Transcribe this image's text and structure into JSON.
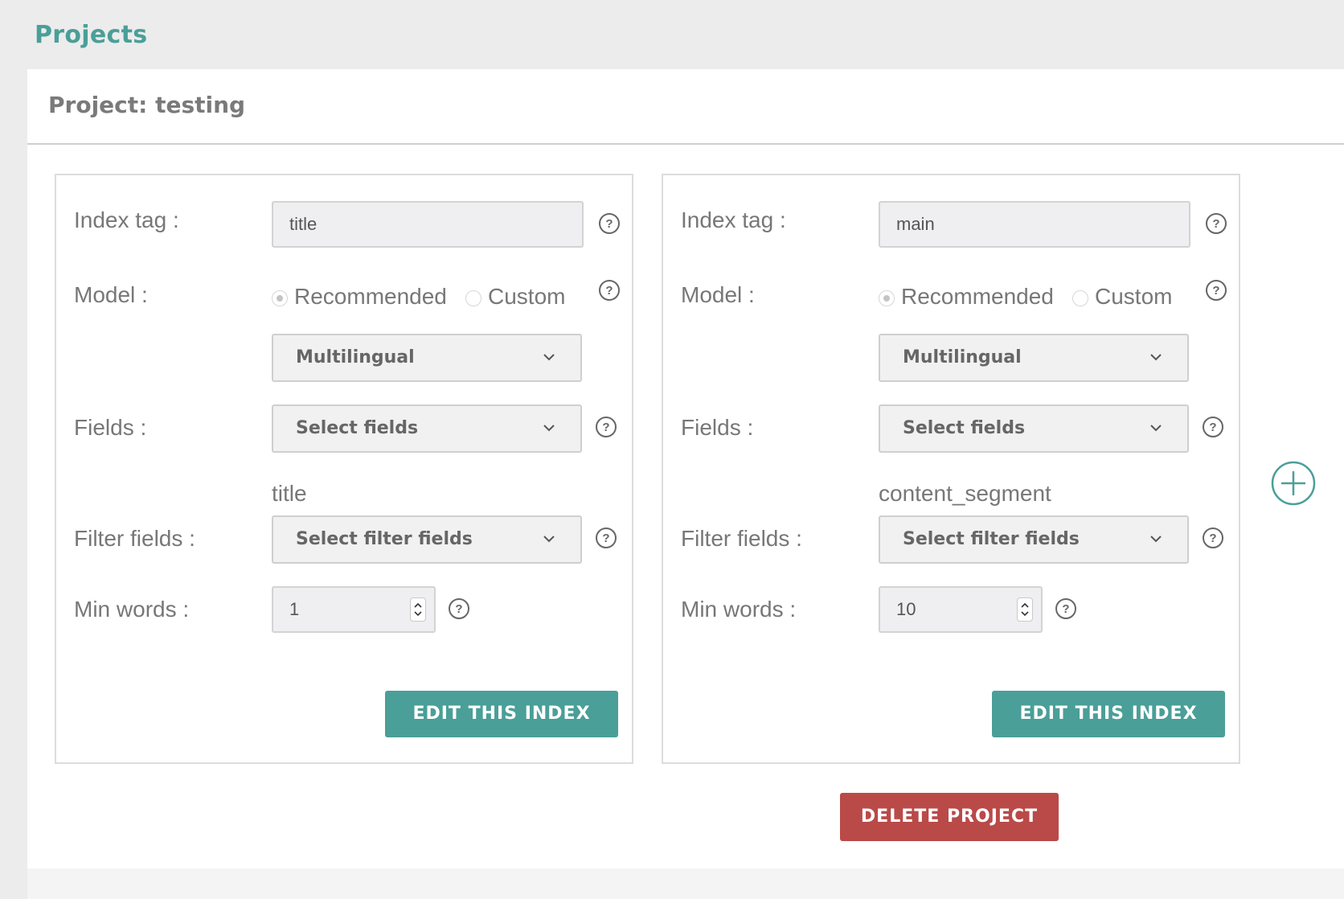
{
  "header": {
    "title": "Projects"
  },
  "project": {
    "title": "Project: testing"
  },
  "labels": {
    "index_tag": "Index tag :",
    "model": "Model :",
    "fields": "Fields :",
    "filter_fields": "Filter fields :",
    "min_words": "Min words :"
  },
  "model_options": {
    "recommended": "Recommended",
    "custom": "Custom"
  },
  "cards": [
    {
      "index_tag": "title",
      "model_selected": "Recommended",
      "model_value": "Multilingual",
      "fields_placeholder": "Select fields",
      "fields_value": "title",
      "filter_fields_placeholder": "Select filter fields",
      "min_words": "1",
      "edit_label": "EDIT THIS INDEX"
    },
    {
      "index_tag": "main",
      "model_selected": "Recommended",
      "model_value": "Multilingual",
      "fields_placeholder": "Select fields",
      "fields_value": "content_segment",
      "filter_fields_placeholder": "Select filter fields",
      "min_words": "10",
      "edit_label": "EDIT THIS INDEX"
    }
  ],
  "actions": {
    "delete_label": "DELETE PROJECT",
    "add_icon": "plus-circle-icon"
  },
  "colors": {
    "accent": "#4a9f98",
    "danger": "#b94a48",
    "background": "#ececec"
  },
  "icons": {
    "help": "question-circle-icon",
    "dropdown": "chevron-down-icon",
    "stepper": "spin-arrows-icon"
  }
}
